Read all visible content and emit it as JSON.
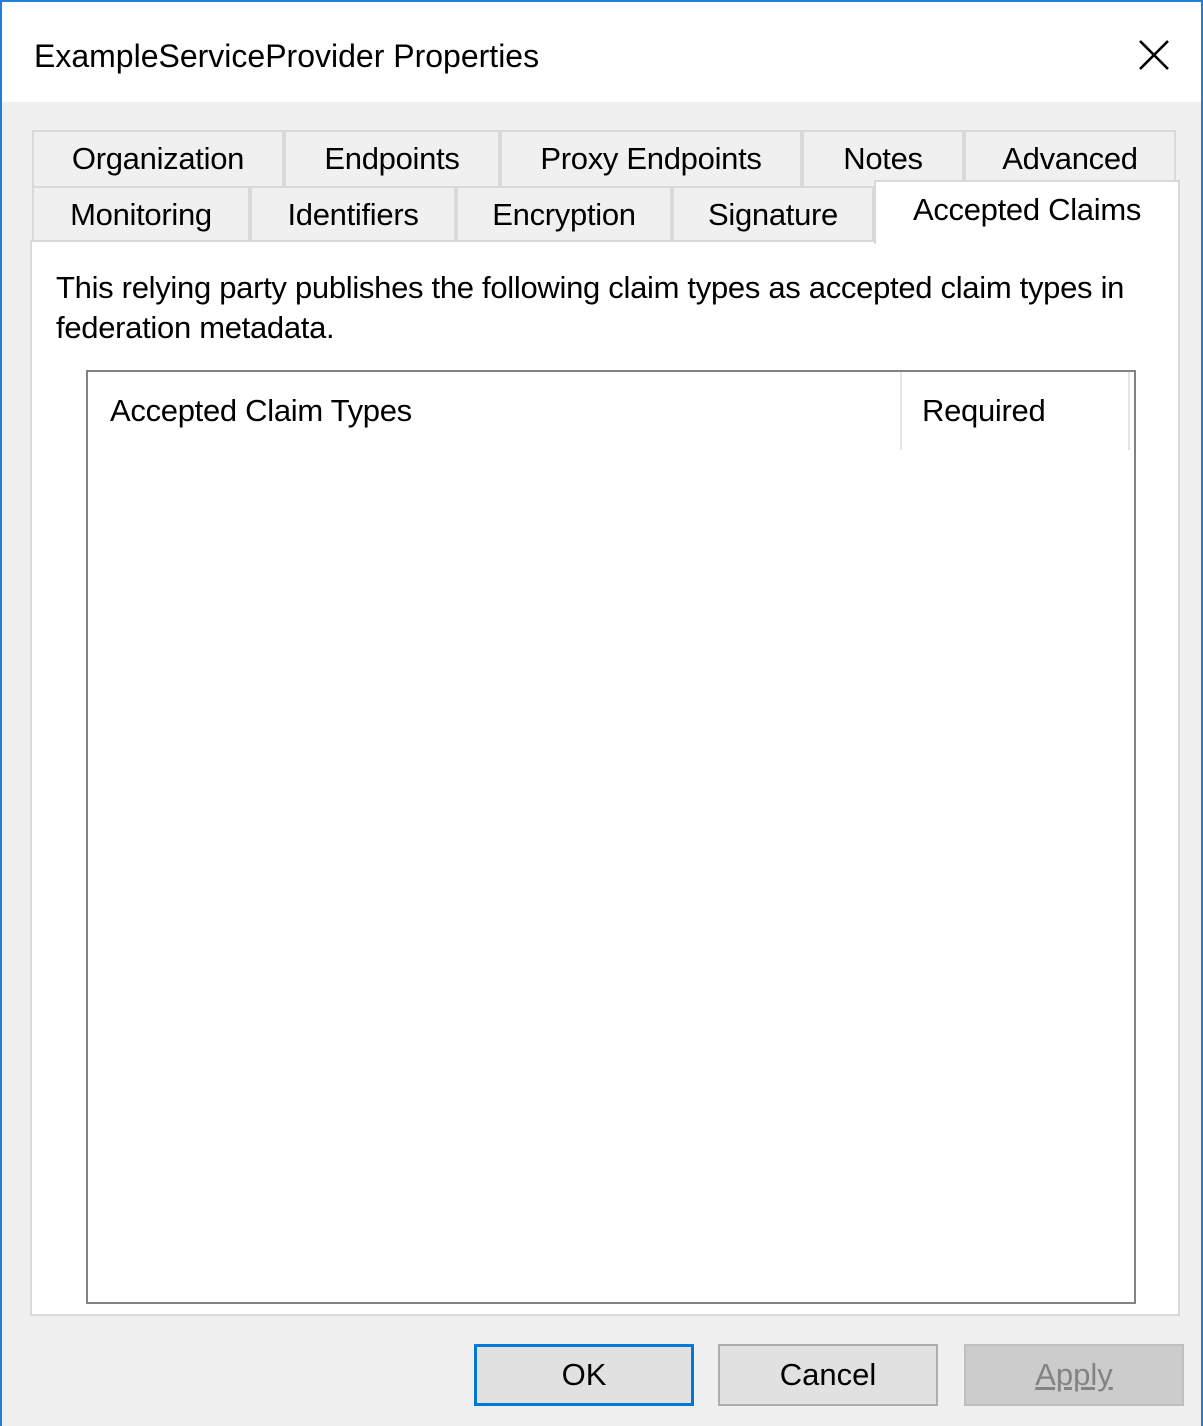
{
  "window": {
    "title": "ExampleServiceProvider Properties",
    "close_icon": "close-icon"
  },
  "tabs": {
    "row1": [
      "Organization",
      "Endpoints",
      "Proxy Endpoints",
      "Notes",
      "Advanced"
    ],
    "row2": [
      "Monitoring",
      "Identifiers",
      "Encryption",
      "Signature",
      "Accepted Claims"
    ],
    "active": "Accepted Claims"
  },
  "panel": {
    "description": "This relying party publishes the following claim types as accepted claim types in federation metadata.",
    "list": {
      "columns": [
        "Accepted Claim Types",
        "Required"
      ],
      "rows": []
    }
  },
  "buttons": {
    "ok": "OK",
    "cancel": "Cancel",
    "apply": "Apply",
    "apply_disabled": true
  },
  "colors": {
    "accent": "#0078d7",
    "window_border": "#1f7ed8",
    "dialog_bg": "#f0f0f0"
  }
}
